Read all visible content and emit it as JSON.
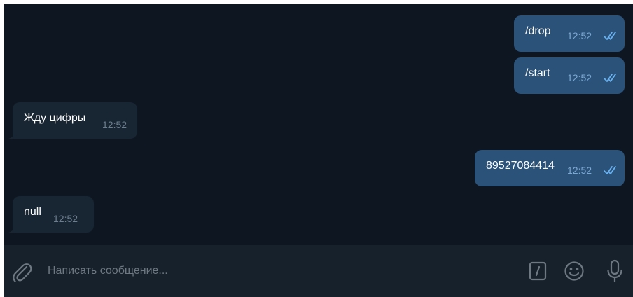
{
  "messages": [
    {
      "direction": "outgoing",
      "text": "/drop",
      "time": "12:52",
      "status": "read-double-check"
    },
    {
      "direction": "outgoing",
      "text": "/start",
      "time": "12:52",
      "status": "read-double-check"
    },
    {
      "direction": "incoming",
      "text": "Жду цифры",
      "time": "12:52"
    },
    {
      "direction": "outgoing",
      "text": "89527084414",
      "time": "12:52",
      "status": "read-double-check"
    },
    {
      "direction": "incoming",
      "text": "null",
      "time": "12:52"
    }
  ],
  "composer": {
    "placeholder": "Написать сообщение...",
    "value": "",
    "icons": [
      "paperclip-icon",
      "bot-command-icon",
      "emoji-icon",
      "microphone-icon"
    ]
  },
  "colors": {
    "chat_background": "#0e1621",
    "outgoing_bubble": "#2b5278",
    "incoming_bubble": "#182533",
    "composer_background": "#17212b",
    "outgoing_time": "#7da8d3",
    "incoming_time": "#6d7f8f",
    "read_check": "#6ab3f3",
    "icon_gray": "#6d7883"
  }
}
